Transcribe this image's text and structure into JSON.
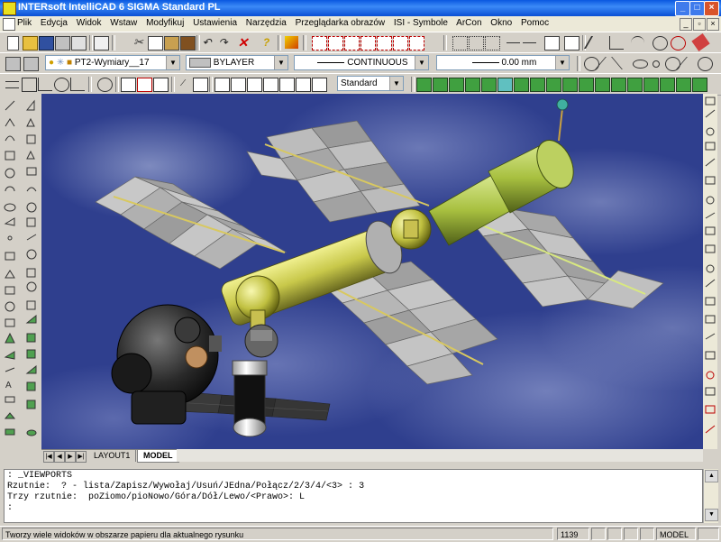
{
  "window": {
    "title": "INTERsoft IntelliCAD 6 SIGMA Standard PL",
    "controls": [
      "_",
      "□",
      "×"
    ]
  },
  "menu": {
    "items": [
      "Plik",
      "Edycja",
      "Widok",
      "Wstaw",
      "Modyfikuj",
      "Ustawienia",
      "Narzędzia",
      "Przeglądarka obrazów",
      "ISI - Symbole",
      "ArCon",
      "Okno",
      "Pomoc"
    ]
  },
  "properties": {
    "layer": "PT2-Wymiary__17",
    "color": "BYLAYER",
    "linetype": "CONTINUOUS",
    "lineweight": "0.00 mm",
    "text_style": "Standard"
  },
  "tabs": {
    "items": [
      "LAYOUT1",
      "MODEL"
    ],
    "active": "MODEL"
  },
  "command": {
    "lines": [
      ": _VIEWPORTS",
      "Rzutnie:  ? - lista/Zapisz/Wywołaj/Usuń/JEdna/Połącz/2/3/4/<3> : 3",
      "Trzy rzutnie:  poZiomo/pioNowo/Góra/Dół/Lewo/<Prawo>: L",
      ":"
    ]
  },
  "status": {
    "message": "Tworzy wiele widoków w obszarze papieru dla aktualnego rysunku",
    "coords": "1139",
    "mode": "MODEL"
  },
  "colors": {
    "titlebar": "#0a58e0",
    "viewport_bg": "#2f3f8e",
    "module_yellow": "#c8c84a",
    "module_green": "#a8c040"
  }
}
